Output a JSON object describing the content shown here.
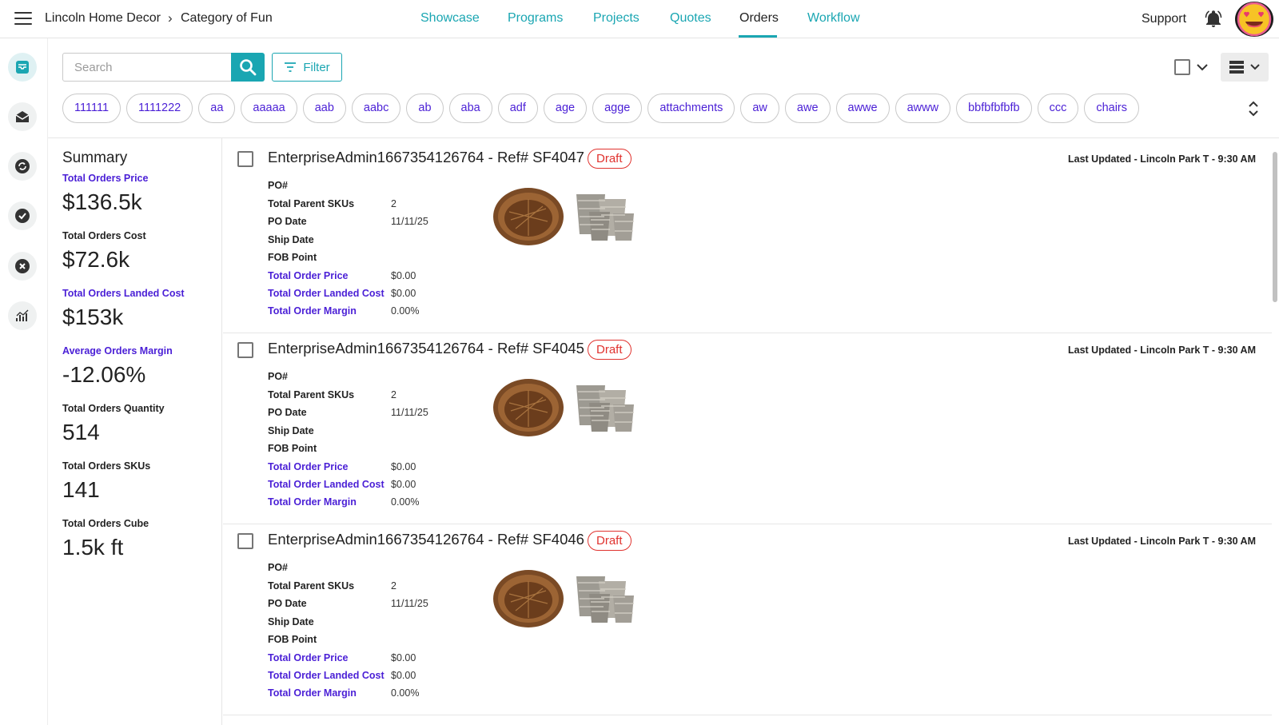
{
  "header": {
    "breadcrumb": [
      "Lincoln Home Decor",
      "Category of Fun"
    ],
    "nav": [
      "Showcase",
      "Programs",
      "Projects",
      "Quotes",
      "Orders",
      "Workflow"
    ],
    "active_nav": "Orders",
    "support_label": "Support",
    "icons": [
      "menu-icon",
      "bell-icon",
      "avatar"
    ]
  },
  "rail": {
    "icons": [
      "inbox-icon",
      "mail-icon",
      "sync-icon",
      "check-circle-icon",
      "cancel-circle-icon",
      "analytics-icon"
    ]
  },
  "toolbar": {
    "search_placeholder": "Search",
    "filter_label": "Filter",
    "accent_color": "#1aa6b2"
  },
  "tags": [
    "111111",
    "1111222",
    "aa",
    "aaaaa",
    "aab",
    "aabc",
    "ab",
    "aba",
    "adf",
    "age",
    "agge",
    "attachments",
    "aw",
    "awe",
    "awwe",
    "awww",
    "bbfbfbfbfb",
    "ccc",
    "chairs"
  ],
  "summary": {
    "title": "Summary",
    "stats": [
      {
        "label": "Total Orders Price",
        "value": "$136.5k",
        "highlight": true
      },
      {
        "label": "Total Orders Cost",
        "value": "$72.6k",
        "highlight": false
      },
      {
        "label": "Total Orders Landed Cost",
        "value": "$153k",
        "highlight": true
      },
      {
        "label": "Average Orders Margin",
        "value": "-12.06%",
        "highlight": true
      },
      {
        "label": "Total Orders Quantity",
        "value": "514",
        "highlight": false
      },
      {
        "label": "Total Orders SKUs",
        "value": "141",
        "highlight": false
      },
      {
        "label": "Total Orders Cube",
        "value": "1.5k ft",
        "highlight": false
      }
    ]
  },
  "orders": [
    {
      "title": "EnterpriseAdmin1667354126764 - Ref# SF4047",
      "status": "Draft",
      "last_updated": "Last Updated - Lincoln Park T - 9:30 AM",
      "fields": [
        {
          "label": "PO#",
          "value": "",
          "highlight": false
        },
        {
          "label": "Total Parent SKUs",
          "value": "2",
          "highlight": false
        },
        {
          "label": "PO Date",
          "value": "11/11/25",
          "highlight": false
        },
        {
          "label": "Ship Date",
          "value": "",
          "highlight": false
        },
        {
          "label": "FOB Point",
          "value": "",
          "highlight": false
        },
        {
          "label": "Total Order Price",
          "value": "$0.00",
          "highlight": true
        },
        {
          "label": "Total Order Landed Cost",
          "value": "$0.00",
          "highlight": true
        },
        {
          "label": "Total Order Margin",
          "value": "0.00%",
          "highlight": true
        }
      ]
    },
    {
      "title": "EnterpriseAdmin1667354126764 - Ref# SF4045",
      "status": "Draft",
      "last_updated": "Last Updated - Lincoln Park T - 9:30 AM",
      "fields": [
        {
          "label": "PO#",
          "value": "",
          "highlight": false
        },
        {
          "label": "Total Parent SKUs",
          "value": "2",
          "highlight": false
        },
        {
          "label": "PO Date",
          "value": "11/11/25",
          "highlight": false
        },
        {
          "label": "Ship Date",
          "value": "",
          "highlight": false
        },
        {
          "label": "FOB Point",
          "value": "",
          "highlight": false
        },
        {
          "label": "Total Order Price",
          "value": "$0.00",
          "highlight": true
        },
        {
          "label": "Total Order Landed Cost",
          "value": "$0.00",
          "highlight": true
        },
        {
          "label": "Total Order Margin",
          "value": "0.00%",
          "highlight": true
        }
      ]
    },
    {
      "title": "EnterpriseAdmin1667354126764 - Ref# SF4046",
      "status": "Draft",
      "last_updated": "Last Updated - Lincoln Park T - 9:30 AM",
      "fields": [
        {
          "label": "PO#",
          "value": "",
          "highlight": false
        },
        {
          "label": "Total Parent SKUs",
          "value": "2",
          "highlight": false
        },
        {
          "label": "PO Date",
          "value": "11/11/25",
          "highlight": false
        },
        {
          "label": "Ship Date",
          "value": "",
          "highlight": false
        },
        {
          "label": "FOB Point",
          "value": "",
          "highlight": false
        },
        {
          "label": "Total Order Price",
          "value": "$0.00",
          "highlight": true
        },
        {
          "label": "Total Order Landed Cost",
          "value": "$0.00",
          "highlight": true
        },
        {
          "label": "Total Order Margin",
          "value": "0.00%",
          "highlight": true
        }
      ]
    }
  ],
  "colors": {
    "accent": "#1aa6b2",
    "link": "#4a1fd6",
    "draft": "#e0322e"
  }
}
